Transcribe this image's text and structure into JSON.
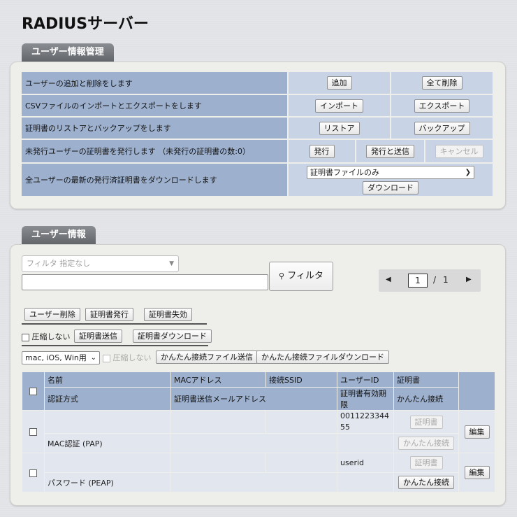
{
  "page": {
    "title": "RADIUSサーバー"
  },
  "management": {
    "tab_label": "ユーザー情報管理",
    "rows": [
      {
        "description": "ユーザーの追加と削除をします",
        "buttons": [
          "追加",
          "全て削除"
        ]
      },
      {
        "description": "CSVファイルのインポートとエクスポートをします",
        "buttons": [
          "インポート",
          "エクスポート"
        ]
      },
      {
        "description": "証明書のリストアとバックアップをします",
        "buttons": [
          "リストア",
          "バックアップ"
        ]
      },
      {
        "description": "未発行ユーザーの証明書を発行します （未発行の証明書の数:0）",
        "buttons": [
          "発行",
          "発行と送信",
          "キャンセル"
        ]
      },
      {
        "description": "全ユーザーの最新の発行済証明書をダウンロードします",
        "select_value": "証明書ファイルのみ",
        "buttons": [
          "ダウンロード"
        ]
      }
    ]
  },
  "users": {
    "tab_label": "ユーザー情報",
    "filter": {
      "placeholder": "フィルタ 指定なし",
      "text_value": "",
      "button_label": "フィルタ"
    },
    "pager": {
      "current_page": "1",
      "separator": "/",
      "total_pages": "1",
      "prev_icon": "triangle-left",
      "next_icon": "triangle-right"
    },
    "action_buttons": {
      "delete_user": "ユーザー削除",
      "issue_cert": "証明書発行",
      "revoke_cert": "証明書失効"
    },
    "cert_tools": {
      "no_compress_label": "圧縮しない",
      "send_cert": "証明書送信",
      "download_cert": "証明書ダウンロード"
    },
    "easy_tools": {
      "os_select_value": "mac, iOS, Win用",
      "no_compress_label": "圧縮しない",
      "send_easy_file": "かんたん接続ファイル送信",
      "download_easy_file": "かんたん接続ファイルダウンロード"
    },
    "table": {
      "headers_row1": [
        "名前",
        "MACアドレス",
        "接続SSID",
        "ユーザーID",
        "証明書"
      ],
      "headers_row2": [
        "認証方式",
        "証明書送信メールアドレス",
        "証明書有効期限",
        "かんたん接続"
      ],
      "rows": [
        {
          "name": "",
          "mac": "",
          "ssid": "",
          "user_id": "0011223344\n55",
          "auth": "MAC認証 (PAP)",
          "email": "",
          "expiry": "",
          "cert_button": "証明書",
          "easy_button": "かんたん接続",
          "edit_button": "編集",
          "easy_enabled": false
        },
        {
          "name": "",
          "mac": "",
          "ssid": "",
          "user_id": "userid",
          "auth": "パスワード (PEAP)",
          "email": "",
          "expiry": "",
          "cert_button": "証明書",
          "easy_button": "かんたん接続",
          "edit_button": "編集",
          "easy_enabled": true
        }
      ]
    }
  }
}
